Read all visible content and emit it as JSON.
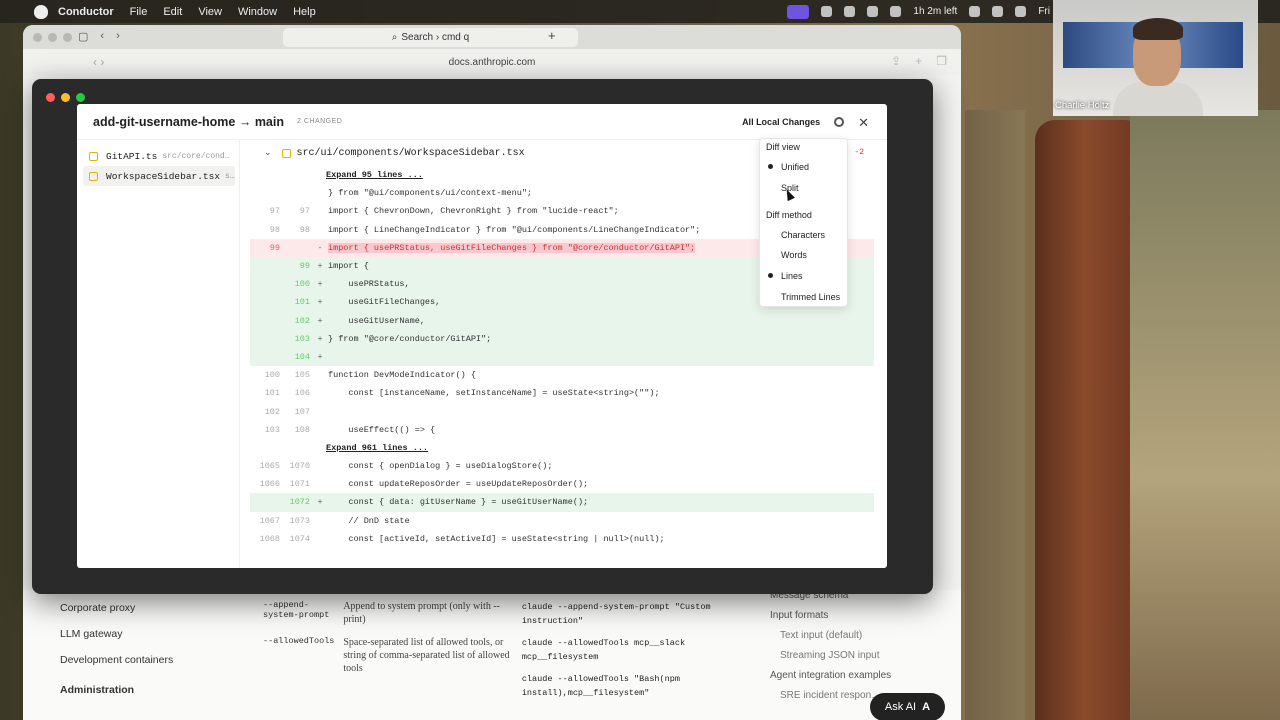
{
  "menubar": {
    "app": "Conductor",
    "items": [
      "File",
      "Edit",
      "View",
      "Window",
      "Help"
    ],
    "time_left": "1h 2m left",
    "clock": "Fri"
  },
  "browser": {
    "tab_search": "Search › cmd q",
    "url": "docs.anthropic.com"
  },
  "modal": {
    "title": "add-git-username-home → main",
    "changed_badge": "2 CHANGED",
    "all_local_changes": "All Local Changes",
    "files": [
      {
        "name": "GitAPI.ts",
        "path": "src/core/cond…"
      },
      {
        "name": "WorkspaceSidebar.tsx",
        "path": "s…"
      }
    ],
    "diff_file": "src/ui/components/WorkspaceSidebar.tsx",
    "diff_counts": "-2",
    "expand_1": "Expand 95 lines ...",
    "expand_2": "Expand 961 lines ...",
    "lines": [
      {
        "type": "ctx",
        "l1": "",
        "l2": "",
        "sign": "",
        "code": "} from \"@ui/components/ui/context-menu\";"
      },
      {
        "type": "ctx",
        "l1": "97",
        "l2": "97",
        "sign": "",
        "code": "import { ChevronDown, ChevronRight } from \"lucide-react\";"
      },
      {
        "type": "ctx",
        "l1": "98",
        "l2": "98",
        "sign": "",
        "code": "import { LineChangeIndicator } from \"@ui/components/LineChangeIndicator\";"
      },
      {
        "type": "del",
        "l1": "99",
        "l2": "",
        "sign": "-",
        "code": "import { usePRStatus, useGitFileChanges } from \"@core/conductor/GitAPI\";"
      },
      {
        "type": "add",
        "l1": "",
        "l2": "99",
        "sign": "+",
        "code": "import {"
      },
      {
        "type": "add",
        "l1": "",
        "l2": "100",
        "sign": "+",
        "code": "    usePRStatus,"
      },
      {
        "type": "add",
        "l1": "",
        "l2": "101",
        "sign": "+",
        "code": "    useGitFileChanges,"
      },
      {
        "type": "add",
        "l1": "",
        "l2": "102",
        "sign": "+",
        "code": "    useGitUserName,"
      },
      {
        "type": "add",
        "l1": "",
        "l2": "103",
        "sign": "+",
        "code": "} from \"@core/conductor/GitAPI\";"
      },
      {
        "type": "add",
        "l1": "",
        "l2": "104",
        "sign": "+",
        "code": ""
      },
      {
        "type": "ctx",
        "l1": "100",
        "l2": "105",
        "sign": "",
        "code": "function DevModeIndicator() {"
      },
      {
        "type": "ctx",
        "l1": "101",
        "l2": "106",
        "sign": "",
        "code": "    const [instanceName, setInstanceName] = useState<string>(\"\");"
      },
      {
        "type": "ctx",
        "l1": "102",
        "l2": "107",
        "sign": "",
        "code": ""
      },
      {
        "type": "ctx",
        "l1": "103",
        "l2": "108",
        "sign": "",
        "code": "    useEffect(() => {"
      }
    ],
    "lines2": [
      {
        "type": "ctx",
        "l1": "1065",
        "l2": "1070",
        "sign": "",
        "code": "    const { openDialog } = useDialogStore();"
      },
      {
        "type": "ctx",
        "l1": "1066",
        "l2": "1071",
        "sign": "",
        "code": "    const updateReposOrder = useUpdateReposOrder();"
      },
      {
        "type": "add",
        "l1": "",
        "l2": "1072",
        "sign": "+",
        "code": "    const { data: gitUserName } = useGitUserName();"
      },
      {
        "type": "ctx",
        "l1": "1067",
        "l2": "1073",
        "sign": "",
        "code": "    // DnD state"
      },
      {
        "type": "ctx",
        "l1": "1068",
        "l2": "1074",
        "sign": "",
        "code": "    const [activeId, setActiveId] = useState<string | null>(null);"
      }
    ]
  },
  "popover": {
    "diff_view_heading": "Diff view",
    "unified": "Unified",
    "split": "Split",
    "diff_method_heading": "Diff method",
    "characters": "Characters",
    "words": "Words",
    "lines": "Lines",
    "trimmed_lines": "Trimmed Lines"
  },
  "docs": {
    "nav": [
      "Corporate proxy",
      "LLM gateway",
      "Development containers"
    ],
    "nav_section": "Administration",
    "rows": [
      {
        "flag": "--append-system-prompt",
        "desc": "Append to system prompt (only with --print)",
        "ex": "claude --append-system-prompt \"Custom instruction\""
      },
      {
        "flag": "--allowedTools",
        "desc": "Space-separated list of allowed tools, or string of comma-separated list of allowed tools",
        "ex": "claude --allowedTools mcp__slack mcp__filesystem"
      }
    ],
    "ex_extra": "claude --allowedTools \"Bash(npm install),mcp__filesystem\"",
    "toc": [
      "Message schema",
      "Input formats",
      "Text input (default)",
      "Streaming JSON input",
      "Agent integration examples",
      "SRE incident respon…"
    ],
    "ask_ai": "Ask AI"
  },
  "webcam": {
    "name": "Charlie Holtz"
  }
}
